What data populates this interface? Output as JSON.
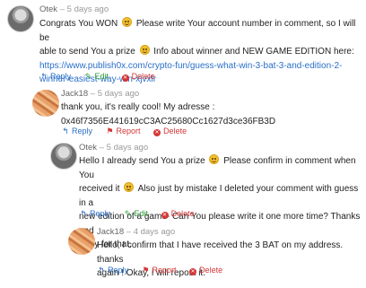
{
  "comments": [
    {
      "author": "Otek",
      "time": "5 days ago",
      "lines": [
        [
          "Congrats You WON ",
          ":emoji:",
          " Please write Your account number in comment, so I will be"
        ],
        [
          "able to send You a prize ",
          ":emoji:",
          " Info about winner and NEW GAME EDITION here:"
        ]
      ],
      "link_line1": "https://www.publish0x.com/crypto-fun/guess-what-win-3-bat-3-and-edition-2-",
      "link_line2": "winner-easiest-way-win-xjvxlr",
      "actions": [
        "Reply",
        "Edit",
        "Delete"
      ]
    },
    {
      "author": "Jack18",
      "time": "5 days ago",
      "line1": "thank you, it's really cool! My adresse :",
      "line2": "0x46f7356E441619cC3AC25680Cc1627d3ce36FB3D",
      "actions": [
        "Reply",
        "Report",
        "Delete"
      ]
    },
    {
      "author": "Otek",
      "time": "5 days ago",
      "line1a": "Hello I already send You a prize ",
      "line1b": " Please confirm in comment when You",
      "line2a": "received it ",
      "line2b": " Also just by mistake I deleted your comment with guess in a",
      "line3": "new edition of a game- Can You please write it one more time? Thanks and",
      "line4": "sorry for that.",
      "actions": [
        "Reply",
        "Edit",
        "Delete"
      ]
    },
    {
      "author": "Jack18",
      "time": "4 days ago",
      "line1": "Hello, I confirm that I have received the 3 BAT on my address. thanks",
      "line2": "again ! Okay, i will repost it.",
      "actions": [
        "Reply",
        "Report",
        "Delete"
      ]
    }
  ]
}
